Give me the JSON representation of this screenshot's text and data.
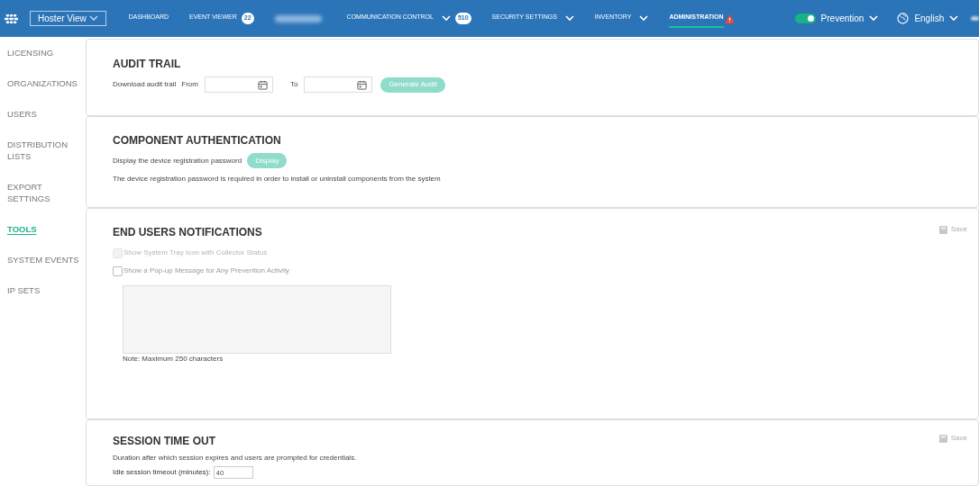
{
  "header": {
    "view_select": {
      "value": "Hoster View"
    },
    "nav": [
      {
        "label": "DASHBOARD",
        "selected": false,
        "dropdown": false
      },
      {
        "label": "EVENT VIEWER",
        "badge": "22",
        "selected": false,
        "dropdown": false
      },
      {
        "label": "COMMUNICATION CONTROL",
        "badge": "510",
        "selected": false,
        "dropdown": true
      },
      {
        "label": "SECURITY SETTINGS",
        "selected": false,
        "dropdown": true
      },
      {
        "label": "INVENTORY",
        "selected": false,
        "dropdown": true
      },
      {
        "label": "ADMINISTRATION",
        "selected": true,
        "dropdown": false,
        "alert": true
      }
    ],
    "mode_toggle": {
      "label": "Prevention",
      "on": true
    },
    "language": {
      "label": "English"
    }
  },
  "sidebar": {
    "items": [
      {
        "label": "LICENSING",
        "selected": false
      },
      {
        "label": "ORGANIZATIONS",
        "selected": false
      },
      {
        "label": "USERS",
        "selected": false
      },
      {
        "label": "DISTRIBUTION LISTS",
        "selected": false
      },
      {
        "label": "EXPORT SETTINGS",
        "selected": false
      },
      {
        "label": "TOOLS",
        "selected": true
      },
      {
        "label": "SYSTEM EVENTS",
        "selected": false
      },
      {
        "label": "IP SETS",
        "selected": false
      }
    ]
  },
  "audit_trail": {
    "title": "AUDIT TRAIL",
    "label": "Download audit trail",
    "from_label": "From",
    "to_label": "To",
    "button": "Generate Audit"
  },
  "component_authentication": {
    "title": "COMPONENT AUTHENTICATION",
    "label": "Display the device registration password",
    "button": "Display",
    "note": "The device registration password is required in order to install or uninstall components from the system"
  },
  "end_users_notifications": {
    "title": "END USERS NOTIFICATIONS",
    "save": "Save",
    "options": [
      {
        "label": "Show System Tray Icon with Collector Status",
        "checked": false,
        "disabled": true
      },
      {
        "label": "Show a Pop-up Message for Any Prevention Activity",
        "checked": false,
        "disabled": false
      }
    ],
    "note": "Note: Maximum 250 characters"
  },
  "session_time_out": {
    "title": "SESSION TIME OUT",
    "save": "Save",
    "description": "Duration after which session expires and users are prompted for credentials.",
    "field_label": "Idle session timeout (minutes):",
    "value": "40"
  }
}
